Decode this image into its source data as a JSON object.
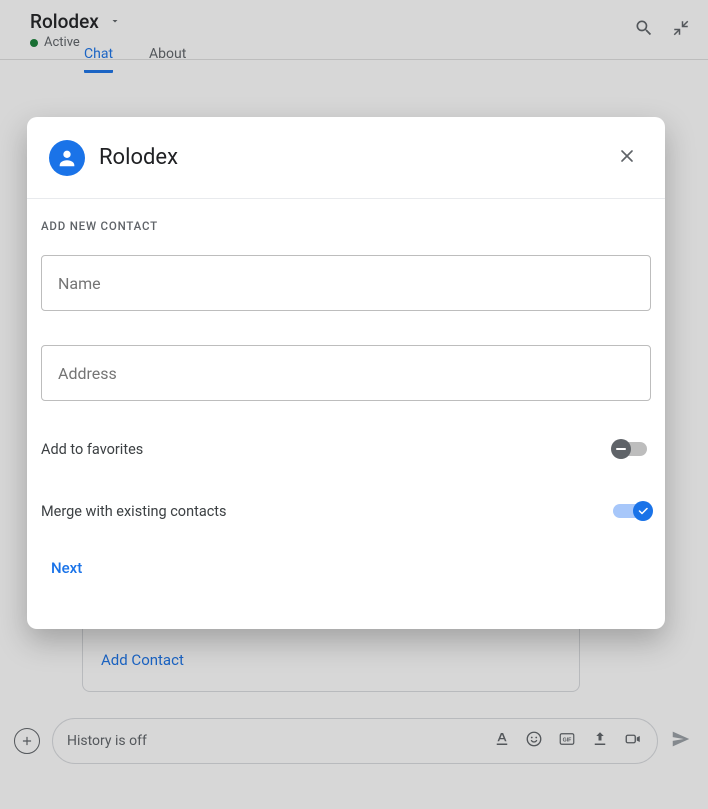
{
  "header": {
    "title": "Rolodex",
    "status": "Active"
  },
  "tabs": {
    "chat": "Chat",
    "about": "About"
  },
  "card": {
    "add_contact": "Add Contact"
  },
  "compose": {
    "placeholder": "History is off"
  },
  "dialog": {
    "title": "Rolodex",
    "section_label": "ADD NEW CONTACT",
    "fields": {
      "name_placeholder": "Name",
      "address_placeholder": "Address"
    },
    "toggles": {
      "favorites_label": "Add to favorites",
      "favorites_on": false,
      "merge_label": "Merge with existing contacts",
      "merge_on": true
    },
    "next_label": "Next"
  }
}
